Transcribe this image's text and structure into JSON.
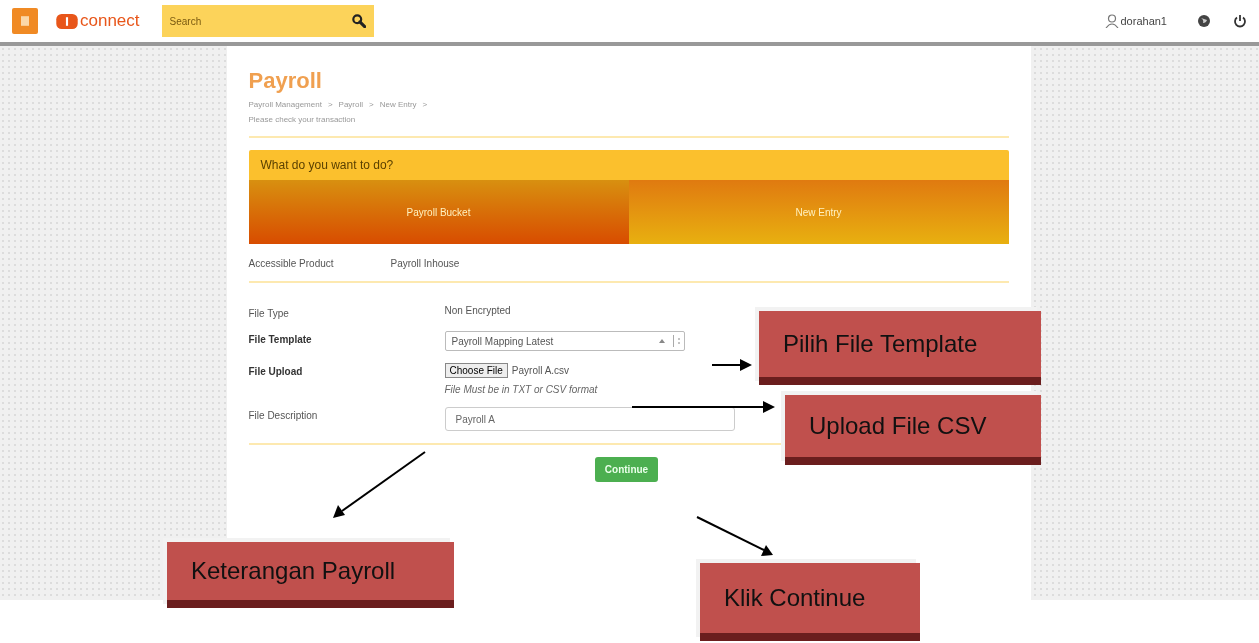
{
  "header": {
    "logo": "connect",
    "search": {
      "placeholder": "Search"
    },
    "user": "dorahan1"
  },
  "page": {
    "title": "Payroll",
    "breadcrumb": [
      "Payroll Management",
      "Payroll",
      "New Entry"
    ],
    "breadcrumb_separator": ">",
    "subtitle": "Please check your transaction"
  },
  "chooser": {
    "question": "What do you want to do?",
    "tabs": [
      {
        "label": "Payroll Bucket",
        "selected": true
      },
      {
        "label": "New Entry",
        "selected": false
      }
    ]
  },
  "product": {
    "label": "Accessible Product",
    "value": "Payroll Inhouse"
  },
  "form": [
    {
      "kind": "text",
      "label": "File Type",
      "value": "Non Encrypted",
      "bold": false
    },
    {
      "kind": "select",
      "label": "File Template",
      "value": "Payroll Mapping Latest",
      "bold": true
    },
    {
      "kind": "file",
      "label": "File Upload",
      "button": "Choose File",
      "value": "Payroll A.csv",
      "hint": "File Must be in TXT or CSV format",
      "bold": true
    },
    {
      "kind": "input",
      "label": "File Description",
      "value": "Payroll A",
      "bold": false
    }
  ],
  "continue_button": "Continue",
  "annotations": [
    {
      "text": "Pilih File Template"
    },
    {
      "text": "Upload File CSV"
    },
    {
      "text": "Keterangan Payroll"
    },
    {
      "text": "Klik Continue"
    }
  ]
}
